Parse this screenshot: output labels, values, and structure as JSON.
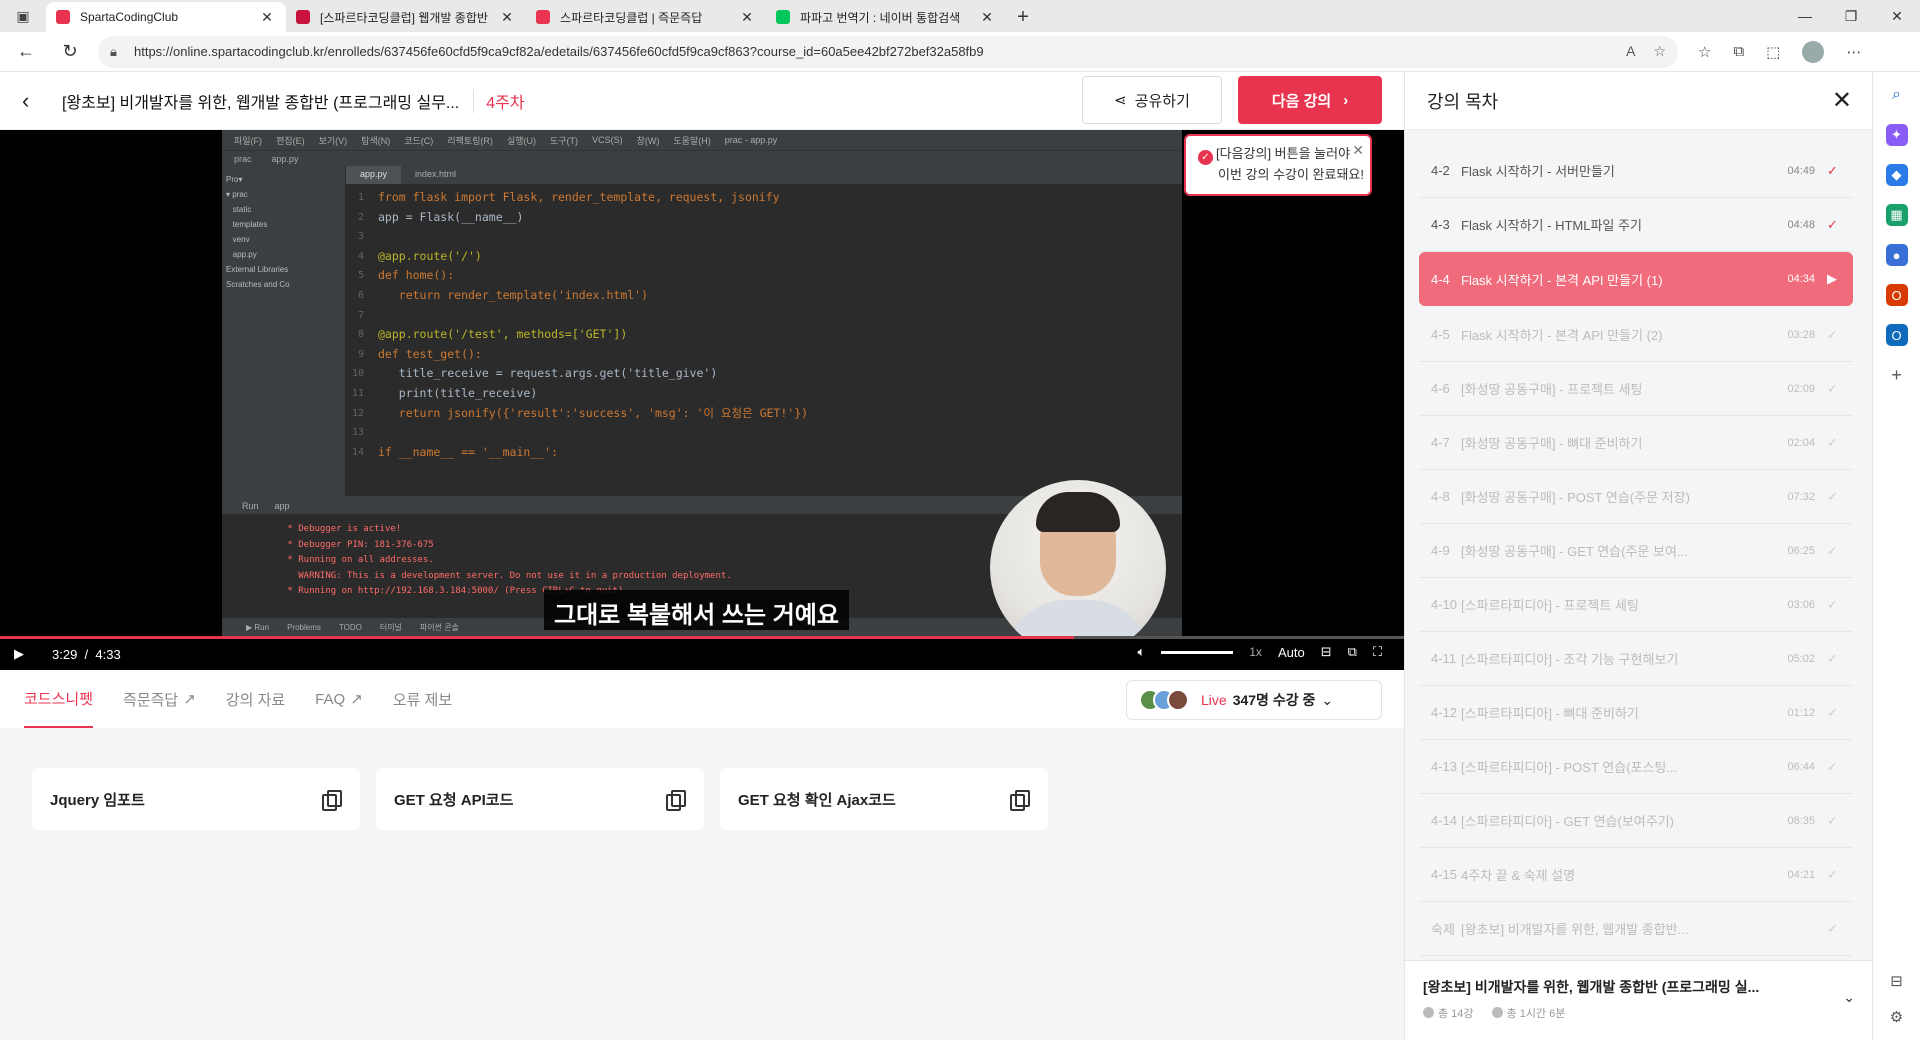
{
  "browser": {
    "tabs": [
      {
        "title": "SpartaCodingClub",
        "active": true,
        "color": "#e8344e"
      },
      {
        "title": "[스파르타코딩클럽] 웹개발 종합반",
        "active": false,
        "color": "#c8143c"
      },
      {
        "title": "스파르타코딩클럽 | 즉문즉답",
        "active": false,
        "color": "#e8344e"
      },
      {
        "title": "파파고 번역기 : 네이버 통합검색",
        "active": false,
        "color": "#03c75a"
      }
    ],
    "url": "https://online.spartacodingclub.kr/enrolleds/637456fe60cfd5f9ca9cf82a/edetails/637456fe60cfd5f9ca9cf863?course_id=60a5ee42bf272bef32a58fb9"
  },
  "header": {
    "course_title": "[왕초보] 비개발자를 위한, 웹개발 종합반 (프로그래밍 실무...",
    "week": "4주차",
    "share_label": "공유하기",
    "next_label": "다음 강의"
  },
  "notice": {
    "line1": "[다음강의] 버튼을 눌러야",
    "line2": "이번 강의 수강이 완료돼요!"
  },
  "video": {
    "subtitle": "그대로 복붙해서 쓰는 거예요",
    "current_time": "3:29",
    "separator": "/",
    "duration": "4:33",
    "progress": 0.765,
    "speed": "1x",
    "quality": "Auto"
  },
  "ide": {
    "menu": [
      "파일(F)",
      "편집(E)",
      "보기(V)",
      "탐색(N)",
      "코드(C)",
      "리팩토링(R)",
      "실행(U)",
      "도구(T)",
      "VCS(S)",
      "창(W)",
      "도움말(H)",
      "prac - app.py"
    ],
    "path": [
      "prac",
      "app.py"
    ],
    "project_tree": [
      "Pro▾",
      "▾ prac",
      "   static",
      "   templates",
      "   venv",
      "   app.py",
      "External Libraries",
      "Scratches and Co"
    ],
    "tabs": [
      "app.py",
      "index.html"
    ],
    "code": [
      {
        "n": "1",
        "t": "from flask import Flask, render_template, request, jsonify"
      },
      {
        "n": "2",
        "t": "app = Flask(__name__)"
      },
      {
        "n": "3",
        "t": ""
      },
      {
        "n": "4",
        "t": "@app.route('/')"
      },
      {
        "n": "5",
        "t": "def home():"
      },
      {
        "n": "6",
        "t": "   return render_template('index.html')"
      },
      {
        "n": "7",
        "t": ""
      },
      {
        "n": "8",
        "t": "@app.route('/test', methods=['GET'])"
      },
      {
        "n": "9",
        "t": "def test_get():"
      },
      {
        "n": "10",
        "t": "   title_receive = request.args.get('title_give')"
      },
      {
        "n": "11",
        "t": "   print(title_receive)"
      },
      {
        "n": "12",
        "t": "   return jsonify({'result':'success', 'msg': '이 요청은 GET!'})"
      },
      {
        "n": "13",
        "t": ""
      },
      {
        "n": "14",
        "t": "if __name__ == '__main__':"
      }
    ],
    "run_tab": "app",
    "run_label": "Run",
    "run_output": [
      " * Debugger is active!",
      " * Debugger PIN: 181-376-675",
      " * Running on all addresses.",
      "   WARNING: This is a development server. Do not use it in a production deployment.",
      " * Running on http://192.168.3.184:5000/ (Press CTRL+C to quit)"
    ],
    "status": [
      "▶ Run",
      "Problems",
      "TODO",
      "터미널",
      "파이썬 콘솔"
    ]
  },
  "bottom_tabs": [
    {
      "label": "코드스니펫",
      "active": true,
      "external": false
    },
    {
      "label": "즉문즉답",
      "active": false,
      "external": true
    },
    {
      "label": "강의 자료",
      "active": false,
      "external": false
    },
    {
      "label": "FAQ",
      "active": false,
      "external": true
    },
    {
      "label": "오류 제보",
      "active": false,
      "external": false
    }
  ],
  "live": {
    "label": "Live",
    "count": "347명 수강 중"
  },
  "snippets": [
    {
      "label": "Jquery 임포트"
    },
    {
      "label": "GET 요청 API코드"
    },
    {
      "label": "GET 요청 확인 Ajax코드"
    }
  ],
  "sidebar": {
    "title": "강의 목차",
    "lessons": [
      {
        "num": "4-2",
        "name": "Flask 시작하기 - 서버만들기",
        "dur": "04:49",
        "state": "done"
      },
      {
        "num": "4-3",
        "name": "Flask 시작하기 - HTML파일 주기",
        "dur": "04:48",
        "state": "done"
      },
      {
        "num": "4-4",
        "name": "Flask 시작하기 - 본격 API 만들기 (1)",
        "dur": "04:34",
        "state": "current"
      },
      {
        "num": "4-5",
        "name": "Flask 시작하기 - 본격 API 만들기 (2)",
        "dur": "03:28",
        "state": "todo"
      },
      {
        "num": "4-6",
        "name": "[화성땅 공동구매] - 프로젝트 세팅",
        "dur": "02:09",
        "state": "todo"
      },
      {
        "num": "4-7",
        "name": "[화성땅 공동구매] - 뼈대 준비하기",
        "dur": "02:04",
        "state": "todo"
      },
      {
        "num": "4-8",
        "name": "[화성땅 공동구매] - POST 연습(주문 저장)",
        "dur": "07:32",
        "state": "todo"
      },
      {
        "num": "4-9",
        "name": "[화성땅 공동구매] - GET 연습(주문 보여...",
        "dur": "06:25",
        "state": "todo"
      },
      {
        "num": "4-10",
        "name": "[스파르타피디아] - 프로젝트 세팅",
        "dur": "03:06",
        "state": "todo"
      },
      {
        "num": "4-11",
        "name": "[스파르타피디아] - 조각 기능 구현해보기",
        "dur": "05:02",
        "state": "todo"
      },
      {
        "num": "4-12",
        "name": "[스파르타피디아] - 뼈대 준비하기",
        "dur": "01:12",
        "state": "todo"
      },
      {
        "num": "4-13",
        "name": "[스파르타피디아] - POST 연습(포스팅...",
        "dur": "06:44",
        "state": "todo"
      },
      {
        "num": "4-14",
        "name": "[스파르타피디아] - GET 연습(보여주기)",
        "dur": "08:35",
        "state": "todo"
      },
      {
        "num": "4-15",
        "name": "4주차 끝 & 숙제 설명",
        "dur": "04:21",
        "state": "todo"
      },
      {
        "num": "숙제",
        "name": "[왕초보] 비개발자를 위한, 웹개발 종합반...",
        "dur": "",
        "state": "todo"
      }
    ],
    "footer_title": "[왕초보] 비개발자를 위한, 웹개발 종합반 (프로그래밍 실...",
    "footer_lessons": "총 14강",
    "footer_time": "총 1시간 6분"
  }
}
